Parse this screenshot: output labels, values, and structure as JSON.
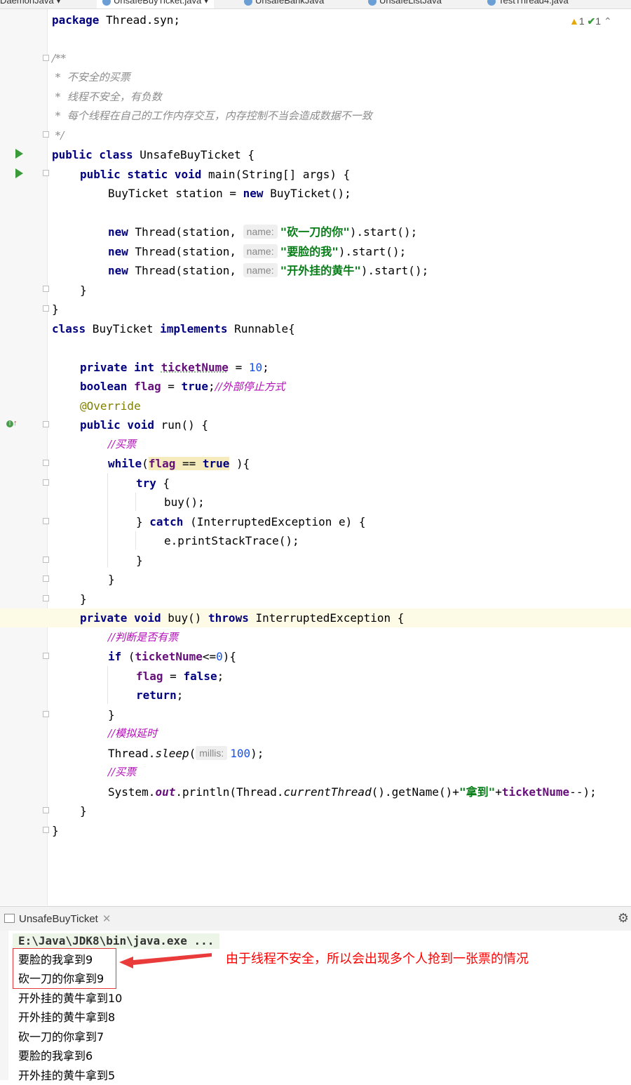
{
  "tabs": [
    "DaemonJava",
    "UnsafeBuyTicket.java",
    "UnsafeBankJava",
    "UnsafeListJava",
    "TestThread4.java"
  ],
  "inspection": {
    "warnings": "1",
    "checks": "1"
  },
  "code": {
    "l1": {
      "kw": "package",
      "rest": " Thread.syn;"
    },
    "c1": "/**",
    "c2": " *  不安全的买票",
    "c3": " *  线程不安全，有负数",
    "c4": " *  每个线程在自己的工作内存交互，内存控制不当会造成数据不一致",
    "c5": " */",
    "cls1": {
      "kw": "public class",
      "rest": " UnsafeBuyTicket {"
    },
    "main": {
      "kw1": "public static void",
      "rest": " main(String[] args) {"
    },
    "station": {
      "pre": "BuyTicket station = ",
      "kw": "new",
      "post": " BuyTicket();"
    },
    "thread_prefix": " Thread(station, ",
    "hint_name": "name:",
    "threads": [
      "\"砍一刀的你\"",
      "\"要脸的我\"",
      "\"开外挂的黄牛\""
    ],
    "start": ").start();",
    "new_kw": "new",
    "close_brace": "}",
    "cls2": {
      "kw": "class",
      "mid": " BuyTicket ",
      "kw2": "implements",
      "rest": " Runnable{"
    },
    "field1": {
      "kw": "private int",
      "name": "ticketNume",
      "eq": " = ",
      "val": "10",
      "end": ";"
    },
    "field2": {
      "kw": "boolean",
      "name": "flag",
      "eq": " = ",
      "val": "true",
      "end": ";",
      "cmt": "//外部停止方式"
    },
    "override": "@Override",
    "run": {
      "kw": "public void",
      "rest": " run() {"
    },
    "cm_buy": "//买票",
    "while": {
      "kw": "while",
      "open": "(",
      "flag": "flag",
      "op": " == ",
      "tru": "true",
      "close": " ){"
    },
    "try": {
      "kw": "try",
      "rest": " {"
    },
    "buycall": "buy();",
    "catch": {
      "pre": "} ",
      "kw": "catch",
      "rest": " (InterruptedException e) {"
    },
    "trace": "e.printStackTrace();",
    "buy": {
      "kw": "private void",
      "mid": " buy() ",
      "kw2": "throws",
      "rest": " InterruptedException {"
    },
    "cm_judge": "//判断是否有票",
    "if": {
      "kw": "if",
      "open": " (",
      "name": "ticketNume",
      "op": "<=",
      "val": "0",
      "close": "){"
    },
    "flagfalse": {
      "name": "flag",
      "eq": " = ",
      "val": "false",
      "end": ";"
    },
    "ret": {
      "kw": "return",
      "end": ";"
    },
    "cm_delay": "//模拟延时",
    "sleep": {
      "pre": "Thread.",
      "m": "sleep",
      "open": "(",
      "hint": "millis:",
      "val": "100",
      "end": ");"
    },
    "println": {
      "pre": "System.",
      "out": "out",
      "mid": ".println(Thread.",
      "ct": "currentThread",
      "mid2": "().getName()+",
      "str": "\"拿到\"",
      "plus": "+",
      "name": "ticketNume",
      "end": "--);"
    }
  },
  "run_panel": {
    "tab": "UnsafeBuyTicket",
    "command": "E:\\Java\\JDK8\\bin\\java.exe ..."
  },
  "console": [
    "要脸的我拿到9",
    "砍一刀的你拿到9",
    "开外挂的黄牛拿到10",
    "开外挂的黄牛拿到8",
    "砍一刀的你拿到7",
    "要脸的我拿到6",
    "开外挂的黄牛拿到5"
  ],
  "annotation": "由于线程不安全，所以会出现多个人抢到一张票的情况",
  "colors": {
    "keyword": "#000080",
    "string": "#067d17",
    "number": "#1750eb",
    "annotation_red": "#ff0000"
  }
}
